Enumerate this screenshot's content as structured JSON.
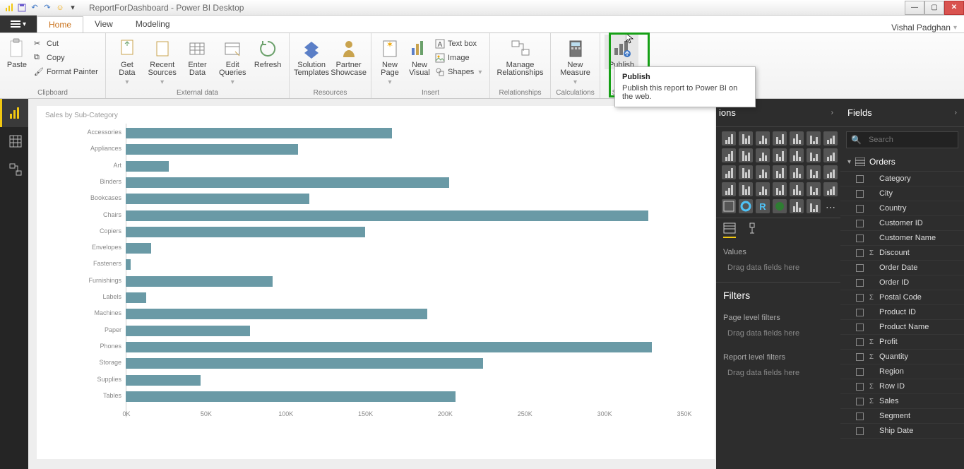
{
  "title": "ReportForDashboard - Power BI Desktop",
  "user": "Vishal Padghan",
  "tabs": {
    "home": "Home",
    "view": "View",
    "modeling": "Modeling"
  },
  "ribbon_groups": {
    "clipboard": {
      "label": "Clipboard",
      "paste": "Paste",
      "cut": "Cut",
      "copy": "Copy",
      "format_painter": "Format Painter"
    },
    "external": {
      "label": "External data",
      "get_data": "Get\nData",
      "recent_sources": "Recent\nSources",
      "enter_data": "Enter\nData",
      "edit_queries": "Edit\nQueries",
      "refresh": "Refresh"
    },
    "resources": {
      "label": "Resources",
      "solution_templates": "Solution\nTemplates",
      "partner_showcase": "Partner\nShowcase"
    },
    "insert": {
      "label": "Insert",
      "new_page": "New\nPage",
      "new_visual": "New\nVisual",
      "text_box": "Text box",
      "image": "Image",
      "shapes": "Shapes"
    },
    "relationships": {
      "label": "Relationships",
      "manage": "Manage\nRelationships"
    },
    "calculations": {
      "label": "Calculations",
      "new_measure": "New\nMeasure"
    },
    "share": {
      "label": "Share",
      "publish": "Publish"
    }
  },
  "tooltip": {
    "title": "Publish",
    "body": "Publish this report to Power BI on the web."
  },
  "chart_title": "Sales by Sub-Category",
  "chart_data": {
    "type": "bar",
    "orientation": "horizontal",
    "title": "Sales by Sub-Category",
    "xlabel": "",
    "ylabel": "",
    "xlim": [
      0,
      350000
    ],
    "xticks": [
      "0K",
      "50K",
      "100K",
      "150K",
      "200K",
      "250K",
      "300K",
      "350K"
    ],
    "categories": [
      "Accessories",
      "Appliances",
      "Art",
      "Binders",
      "Bookcases",
      "Chairs",
      "Copiers",
      "Envelopes",
      "Fasteners",
      "Furnishings",
      "Labels",
      "Machines",
      "Paper",
      "Phones",
      "Storage",
      "Supplies",
      "Tables"
    ],
    "values": [
      167000,
      108000,
      27000,
      203000,
      115000,
      328000,
      150000,
      16000,
      3000,
      92000,
      13000,
      189000,
      78000,
      330000,
      224000,
      47000,
      207000
    ]
  },
  "viz_panel": {
    "header_partial": "ions",
    "values_label": "Values",
    "values_placeholder": "Drag data fields here",
    "filters_header": "Filters",
    "page_filters": "Page level filters",
    "page_filters_placeholder": "Drag data fields here",
    "report_filters": "Report level filters",
    "report_filters_placeholder": "Drag data fields here"
  },
  "fields_panel": {
    "header": "Fields",
    "search_placeholder": "Search",
    "table": "Orders",
    "fields": [
      {
        "name": "Category",
        "sigma": false
      },
      {
        "name": "City",
        "sigma": false
      },
      {
        "name": "Country",
        "sigma": false
      },
      {
        "name": "Customer ID",
        "sigma": false
      },
      {
        "name": "Customer Name",
        "sigma": false
      },
      {
        "name": "Discount",
        "sigma": true
      },
      {
        "name": "Order Date",
        "sigma": false
      },
      {
        "name": "Order ID",
        "sigma": false
      },
      {
        "name": "Postal Code",
        "sigma": true
      },
      {
        "name": "Product ID",
        "sigma": false
      },
      {
        "name": "Product Name",
        "sigma": false
      },
      {
        "name": "Profit",
        "sigma": true
      },
      {
        "name": "Quantity",
        "sigma": true
      },
      {
        "name": "Region",
        "sigma": false
      },
      {
        "name": "Row ID",
        "sigma": true
      },
      {
        "name": "Sales",
        "sigma": true
      },
      {
        "name": "Segment",
        "sigma": false
      },
      {
        "name": "Ship Date",
        "sigma": false
      }
    ]
  }
}
